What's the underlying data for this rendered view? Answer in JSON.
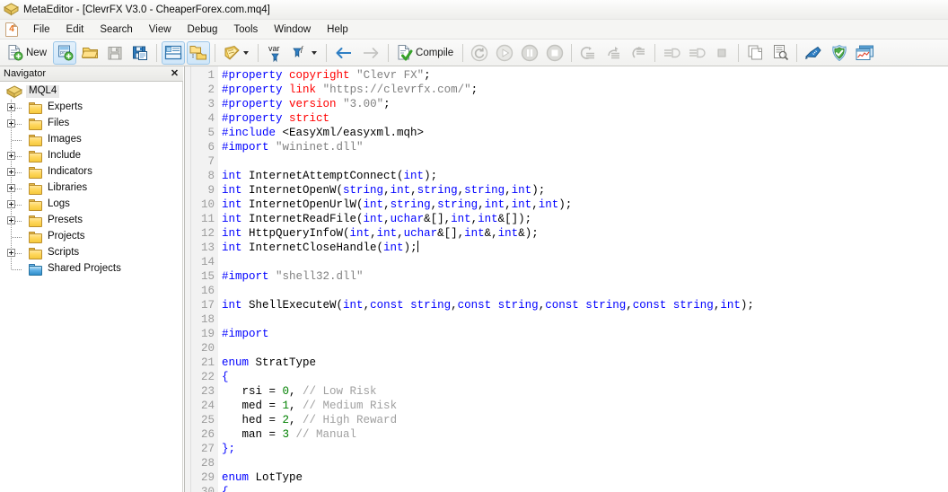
{
  "window": {
    "title": "MetaEditor - [ClevrFX V3.0 - CheaperForex.com.mq4]",
    "app_icon": "metaeditor-diamond-icon"
  },
  "menubar": {
    "badge": "4",
    "items": [
      {
        "label": "File",
        "name": "menu-file"
      },
      {
        "label": "Edit",
        "name": "menu-edit"
      },
      {
        "label": "Search",
        "name": "menu-search"
      },
      {
        "label": "View",
        "name": "menu-view"
      },
      {
        "label": "Debug",
        "name": "menu-debug"
      },
      {
        "label": "Tools",
        "name": "menu-tools"
      },
      {
        "label": "Window",
        "name": "menu-window"
      },
      {
        "label": "Help",
        "name": "menu-help"
      }
    ]
  },
  "toolbar": {
    "new_label": "New",
    "compile_label": "Compile",
    "buttons": [
      {
        "name": "new-file-button",
        "icon": "new-document-icon",
        "label": "New"
      },
      {
        "name": "new-project-button",
        "icon": "new-project-icon",
        "label": ""
      },
      {
        "name": "open-button",
        "icon": "open-folder-icon",
        "label": ""
      },
      {
        "name": "save-button",
        "icon": "save-disk-icon",
        "label": ""
      },
      {
        "name": "save-all-button",
        "icon": "save-all-disk-icon",
        "label": ""
      },
      {
        "name": "toggle-navigator-button",
        "icon": "panel-layout-icon",
        "label": ""
      },
      {
        "name": "toggle-folders-button",
        "icon": "folder-tree-icon",
        "label": ""
      },
      {
        "name": "notes-button",
        "icon": "notepad-icon",
        "label": ""
      },
      {
        "name": "variables-button",
        "icon": "var-pin-icon",
        "label": ""
      },
      {
        "name": "functions-button",
        "icon": "function-pin-icon",
        "label": ""
      },
      {
        "name": "back-button",
        "icon": "arrow-left-icon",
        "label": ""
      },
      {
        "name": "forward-button",
        "icon": "arrow-right-icon",
        "label": ""
      },
      {
        "name": "compile-button",
        "icon": "compile-check-icon",
        "label": "Compile"
      },
      {
        "name": "restart-button",
        "icon": "restart-circle-icon",
        "label": ""
      },
      {
        "name": "run-button",
        "icon": "play-circle-icon",
        "label": ""
      },
      {
        "name": "pause-button",
        "icon": "pause-circle-icon",
        "label": ""
      },
      {
        "name": "stop-button",
        "icon": "stop-circle-icon",
        "label": ""
      },
      {
        "name": "step-into-button",
        "icon": "step-into-icon",
        "label": ""
      },
      {
        "name": "step-over-button",
        "icon": "step-over-icon",
        "label": ""
      },
      {
        "name": "step-out-button",
        "icon": "step-out-icon",
        "label": ""
      },
      {
        "name": "debug-start-button",
        "icon": "debug-arrow-icon",
        "label": ""
      },
      {
        "name": "debug-resume-button",
        "icon": "debug-arrow-2-icon",
        "label": ""
      },
      {
        "name": "debug-stop-button",
        "icon": "debug-square-icon",
        "label": ""
      },
      {
        "name": "copy-button",
        "icon": "copy-pages-icon",
        "label": ""
      },
      {
        "name": "inspect-button",
        "icon": "page-magnifier-icon",
        "label": ""
      },
      {
        "name": "style-button",
        "icon": "brush-icon",
        "label": ""
      },
      {
        "name": "security-button",
        "icon": "shield-check-icon",
        "label": ""
      },
      {
        "name": "terminal-button",
        "icon": "terminal-chart-icon",
        "label": ""
      }
    ]
  },
  "navigator": {
    "title": "Navigator",
    "close_label": "✕",
    "root": {
      "label": "MQL4",
      "icon": "mql4-diamond-icon",
      "selected": true
    },
    "items": [
      {
        "label": "Experts",
        "expandable": true,
        "icon": "folder-icon"
      },
      {
        "label": "Files",
        "expandable": true,
        "icon": "folder-icon"
      },
      {
        "label": "Images",
        "expandable": false,
        "icon": "folder-icon"
      },
      {
        "label": "Include",
        "expandable": true,
        "icon": "folder-icon"
      },
      {
        "label": "Indicators",
        "expandable": true,
        "icon": "folder-icon"
      },
      {
        "label": "Libraries",
        "expandable": true,
        "icon": "folder-icon"
      },
      {
        "label": "Logs",
        "expandable": true,
        "icon": "folder-icon"
      },
      {
        "label": "Presets",
        "expandable": true,
        "icon": "folder-icon"
      },
      {
        "label": "Projects",
        "expandable": false,
        "icon": "folder-icon"
      },
      {
        "label": "Scripts",
        "expandable": true,
        "icon": "folder-icon"
      },
      {
        "label": "Shared Projects",
        "expandable": false,
        "icon": "folder-blue-icon",
        "blue": true
      }
    ]
  },
  "editor": {
    "first_line": 1,
    "last_line": 30,
    "lines": [
      {
        "n": 1,
        "html": "<span class='k'>#property</span> <span class='pp'>copyright</span> <span class='str'>\"Clevr FX\"</span>;"
      },
      {
        "n": 2,
        "html": "<span class='k'>#property</span> <span class='pp'>link</span> <span class='str'>\"https://clevrfx.com/\"</span>;"
      },
      {
        "n": 3,
        "html": "<span class='k'>#property</span> <span class='pp'>version</span> <span class='str'>\"3.00\"</span>;"
      },
      {
        "n": 4,
        "html": "<span class='k'>#property</span> <span class='pp'>strict</span>"
      },
      {
        "n": 5,
        "html": "<span class='k'>#include</span> &lt;EasyXml/easyxml.mqh&gt;"
      },
      {
        "n": 6,
        "html": "<span class='k'>#import</span> <span class='str'>\"wininet.dll\"</span>"
      },
      {
        "n": 7,
        "html": ""
      },
      {
        "n": 8,
        "html": "<span class='k'>int</span> InternetAttemptConnect(<span class='k'>int</span>);"
      },
      {
        "n": 9,
        "html": "<span class='k'>int</span> InternetOpenW(<span class='k'>string</span>,<span class='k'>int</span>,<span class='k'>string</span>,<span class='k'>string</span>,<span class='k'>int</span>);"
      },
      {
        "n": 10,
        "html": "<span class='k'>int</span> InternetOpenUrlW(<span class='k'>int</span>,<span class='k'>string</span>,<span class='k'>string</span>,<span class='k'>int</span>,<span class='k'>int</span>,<span class='k'>int</span>);"
      },
      {
        "n": 11,
        "html": "<span class='k'>int</span> InternetReadFile(<span class='k'>int</span>,<span class='k'>uchar</span>&amp;[],<span class='k'>int</span>,<span class='k'>int</span>&amp;[]);"
      },
      {
        "n": 12,
        "html": "<span class='k'>int</span> HttpQueryInfoW(<span class='k'>int</span>,<span class='k'>int</span>,<span class='k'>uchar</span>&amp;[],<span class='k'>int</span>&amp;,<span class='k'>int</span>&amp;);"
      },
      {
        "n": 13,
        "html": "<span class='k'>int</span> InternetCloseHandle(<span class='k'>int</span>);<span class='caret'></span>"
      },
      {
        "n": 14,
        "html": ""
      },
      {
        "n": 15,
        "html": "<span class='k'>#import</span> <span class='str'>\"shell32.dll\"</span>"
      },
      {
        "n": 16,
        "html": ""
      },
      {
        "n": 17,
        "html": "<span class='k'>int</span> ShellExecuteW(<span class='k'>int</span>,<span class='k'>const</span> <span class='k'>string</span>,<span class='k'>const</span> <span class='k'>string</span>,<span class='k'>const</span> <span class='k'>string</span>,<span class='k'>const</span> <span class='k'>string</span>,<span class='k'>int</span>);"
      },
      {
        "n": 18,
        "html": ""
      },
      {
        "n": 19,
        "html": "<span class='k'>#import</span>"
      },
      {
        "n": 20,
        "html": ""
      },
      {
        "n": 21,
        "html": "<span class='k'>enum</span> StratType"
      },
      {
        "n": 22,
        "html": "<span class='k'>{</span>"
      },
      {
        "n": 23,
        "html": "   rsi = <span class='n'>0</span>, <span class='cm'>// Low Risk</span>"
      },
      {
        "n": 24,
        "html": "   med = <span class='n'>1</span>, <span class='cm'>// Medium Risk</span>"
      },
      {
        "n": 25,
        "html": "   hed = <span class='n'>2</span>, <span class='cm'>// High Reward</span>"
      },
      {
        "n": 26,
        "html": "   man = <span class='n'>3</span> <span class='cm'>// Manual</span>"
      },
      {
        "n": 27,
        "html": "<span class='k'>};</span>"
      },
      {
        "n": 28,
        "html": ""
      },
      {
        "n": 29,
        "html": "<span class='k'>enum</span> LotType"
      },
      {
        "n": 30,
        "html": "<span class='k'>{</span>"
      }
    ],
    "plain_text": [
      "#property copyright \"Clevr FX\";",
      "#property link \"https://clevrfx.com/\";",
      "#property version \"3.00\";",
      "#property strict",
      "#include <EasyXml/easyxml.mqh>",
      "#import \"wininet.dll\"",
      "",
      "int InternetAttemptConnect(int);",
      "int InternetOpenW(string,int,string,string,int);",
      "int InternetOpenUrlW(int,string,string,int,int,int);",
      "int InternetReadFile(int,uchar&[],int,int&[]);",
      "int HttpQueryInfoW(int,int,uchar&[],int&,int&);",
      "int InternetCloseHandle(int);",
      "",
      "#import \"shell32.dll\"",
      "",
      "int ShellExecuteW(int,const string,const string,const string,const string,int);",
      "",
      "#import",
      "",
      "enum StratType",
      "{",
      "   rsi = 0, // Low Risk",
      "   med = 1, // Medium Risk",
      "   hed = 2, // High Reward",
      "   man = 3 // Manual",
      "};",
      "",
      "enum LotType",
      "{"
    ]
  },
  "colors": {
    "keyword": "#0000ff",
    "property_arg": "#ff0000",
    "string": "#808080",
    "number": "#008000",
    "comment": "#a0a0a0",
    "gutter_bg": "#f2f2f2",
    "gutter_fg": "#9b9b9b",
    "toolbar_bg": "#f4f4f2"
  }
}
